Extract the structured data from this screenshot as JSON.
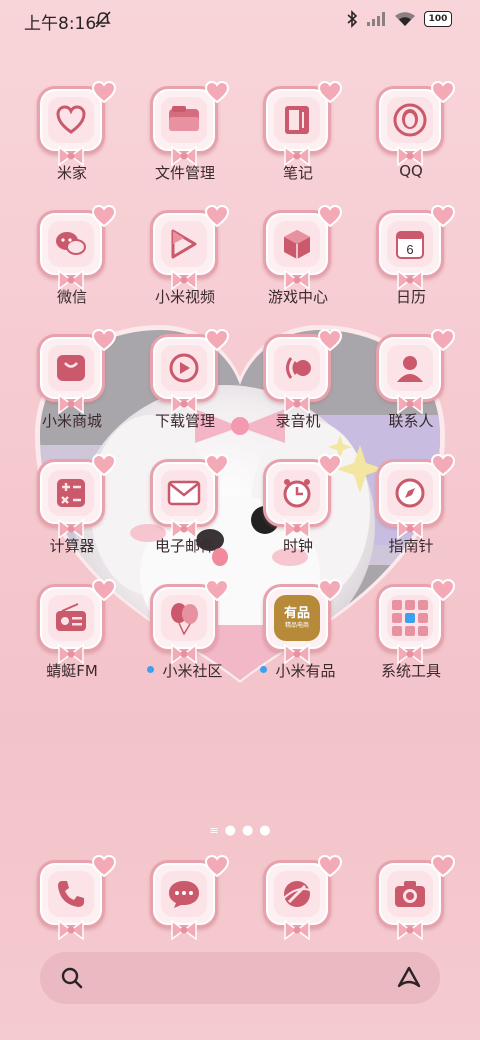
{
  "status_bar": {
    "time": "上午8:16",
    "battery": "100"
  },
  "apps": [
    {
      "label": "米家",
      "icon": "mijia-icon",
      "dot": false
    },
    {
      "label": "文件管理",
      "icon": "folder-icon",
      "dot": false
    },
    {
      "label": "笔记",
      "icon": "notes-icon",
      "dot": false
    },
    {
      "label": "QQ",
      "icon": "qq-icon",
      "dot": false
    },
    {
      "label": "微信",
      "icon": "wechat-icon",
      "dot": false
    },
    {
      "label": "小米视频",
      "icon": "video-play-icon",
      "dot": false
    },
    {
      "label": "游戏中心",
      "icon": "cube-icon",
      "dot": false
    },
    {
      "label": "日历",
      "icon": "calendar-icon",
      "dot": false,
      "badge": "6"
    },
    {
      "label": "小米商城",
      "icon": "shopping-bag-icon",
      "dot": false
    },
    {
      "label": "下载管理",
      "icon": "download-icon",
      "dot": false
    },
    {
      "label": "录音机",
      "icon": "recorder-icon",
      "dot": false
    },
    {
      "label": "联系人",
      "icon": "contact-icon",
      "dot": false
    },
    {
      "label": "计算器",
      "icon": "calculator-icon",
      "dot": false
    },
    {
      "label": "电子邮件",
      "icon": "mail-icon",
      "dot": false
    },
    {
      "label": "时钟",
      "icon": "clock-icon",
      "dot": false
    },
    {
      "label": "指南针",
      "icon": "compass-icon",
      "dot": false
    },
    {
      "label": "蜻蜓FM",
      "icon": "radio-icon",
      "dot": false
    },
    {
      "label": "小米社区",
      "icon": "balloon-icon",
      "dot": true
    },
    {
      "label": "小米有品",
      "icon": "youpin-icon",
      "dot": true,
      "icon_text": "有品",
      "icon_subtext": "精品电商"
    },
    {
      "label": "系统工具",
      "icon": "folder-grid-icon",
      "dot": false
    }
  ],
  "page_indicator": {
    "pages": 3,
    "current": 2
  },
  "dock": [
    {
      "icon": "phone-icon"
    },
    {
      "icon": "message-icon"
    },
    {
      "icon": "browser-icon"
    },
    {
      "icon": "camera-icon"
    }
  ],
  "colors": {
    "accent": "#e7a2ad",
    "icon_glyph": "#c9596b",
    "background": "#f5c9cf"
  }
}
